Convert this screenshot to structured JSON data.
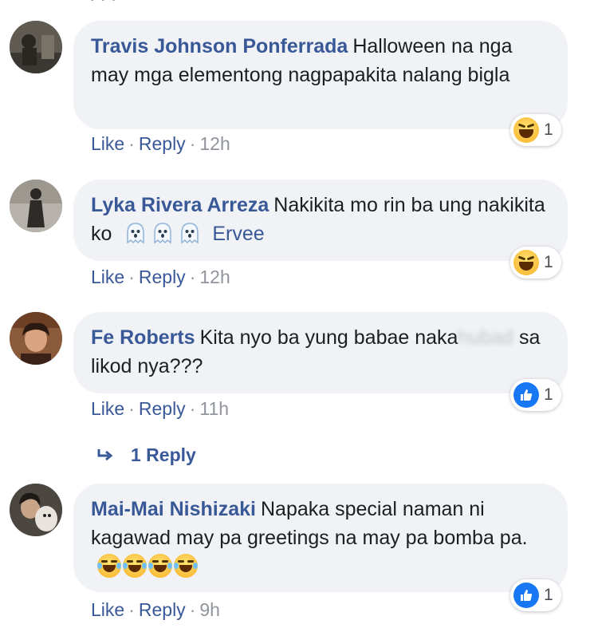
{
  "comments": [
    {
      "author": "Travis Johnson Ponferrada",
      "text": "Halloween na nga may mga elementong nagpapakita nalang bigla",
      "like_label": "Like",
      "reply_label": "Reply",
      "time": "12h",
      "reaction": {
        "type": "haha",
        "count": "1"
      }
    },
    {
      "author": "Lyka Rivera Arreza",
      "text": "Nakikita mo rin ba ung nakikita ko",
      "emoji": "ghost-emoji x3",
      "mention": "Ervee",
      "like_label": "Like",
      "reply_label": "Reply",
      "time": "12h",
      "reaction": {
        "type": "haha",
        "count": "1"
      }
    },
    {
      "author": "Fe Roberts",
      "text_part1": "Kita nyo ba yung babae naka",
      "text_blurred": "hubad",
      "text_part2": " sa likod nya???",
      "like_label": "Like",
      "reply_label": "Reply",
      "time": "11h",
      "reaction": {
        "type": "like",
        "count": "1"
      },
      "replies_label": "1 Reply"
    },
    {
      "author": "Mai-Mai Nishizaki",
      "text": "Napaka special naman ni kagawad may pa greetings na may pa bomba pa.",
      "emoji": "laughing-emoji x4",
      "like_label": "Like",
      "reply_label": "Reply",
      "time": "9h",
      "reaction": {
        "type": "like",
        "count": "1"
      }
    }
  ],
  "colors": {
    "author": "#385898",
    "bubble": "#f0f2f5",
    "meta": "#90949c",
    "like_blue": "#1877f2"
  }
}
